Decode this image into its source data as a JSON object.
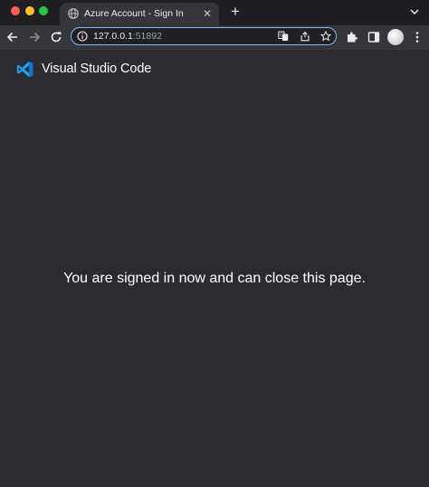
{
  "browser": {
    "tab": {
      "title": "Azure Account - Sign In",
      "favicon": "globe-icon",
      "close_glyph": "✕"
    },
    "new_tab_glyph": "+",
    "omnibox": {
      "host": "127.0.0.1",
      "port": ":51892"
    },
    "colors": {
      "tabstrip": "#1f1f23",
      "toolbar": "#35363a",
      "omnibox_focus": "#8ab4f8"
    }
  },
  "page": {
    "brand": {
      "logo": "vscode-logo-icon",
      "name": "Visual Studio Code"
    },
    "message": "You are signed in now and can close this page.",
    "colors": {
      "background": "#2c2b32",
      "text": "#ffffff",
      "logo_blue": "#1f9cf0"
    }
  }
}
